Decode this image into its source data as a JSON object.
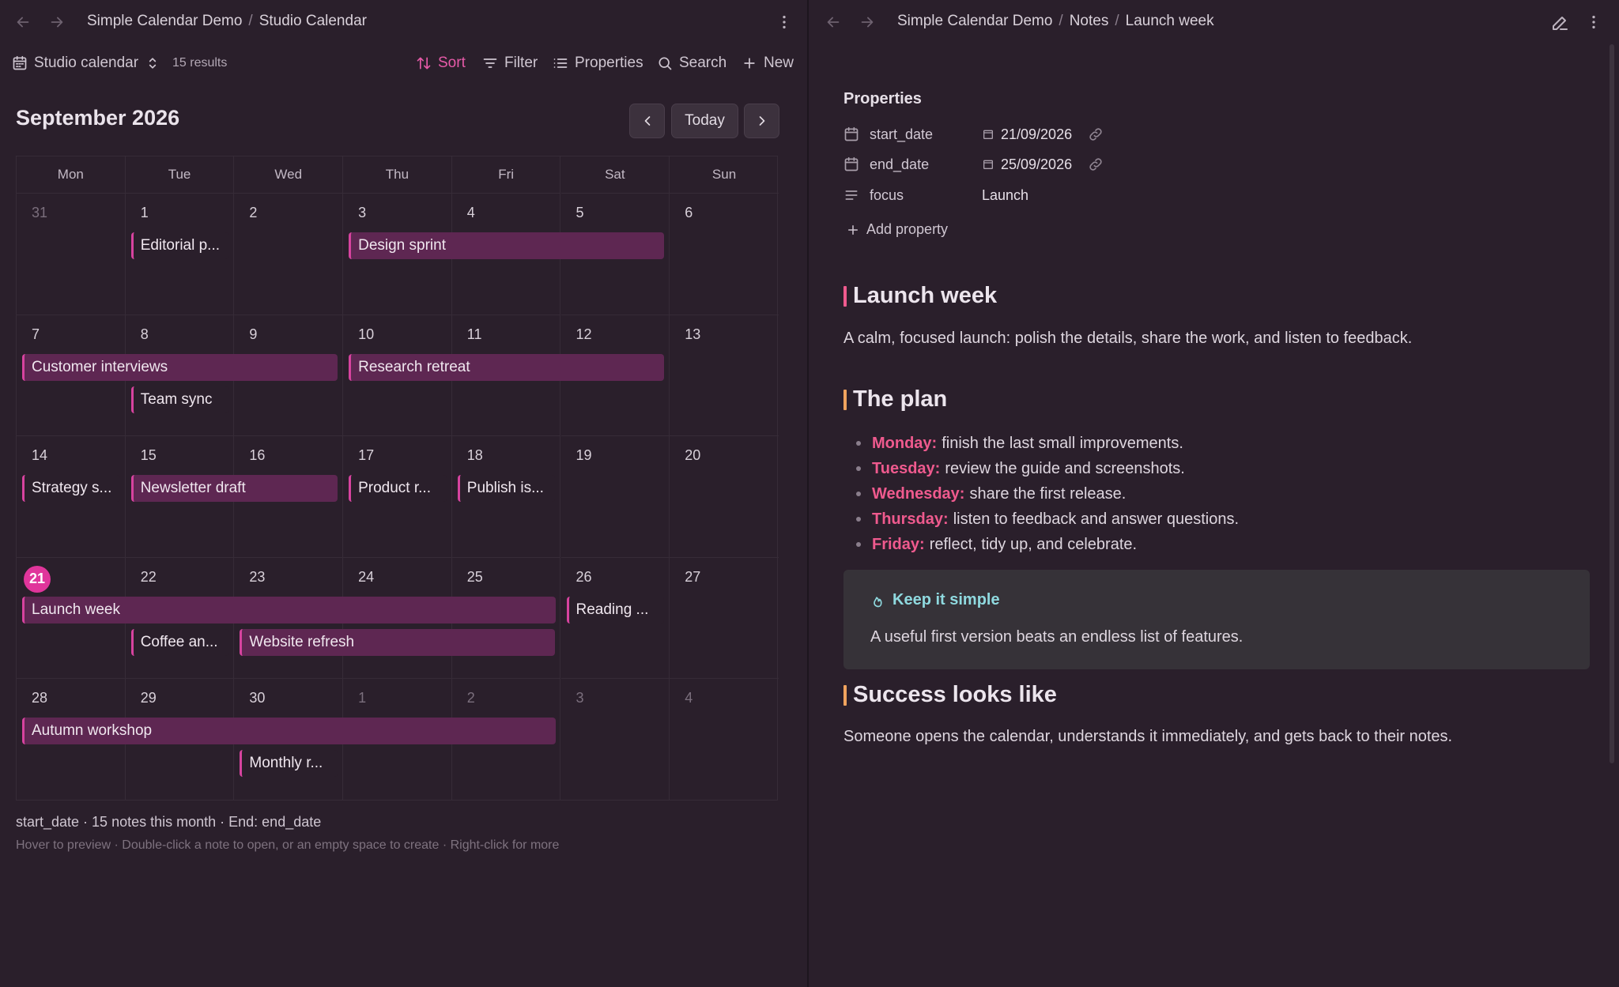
{
  "left": {
    "breadcrumb": [
      "Simple Calendar Demo",
      "Studio Calendar"
    ],
    "toolbar": {
      "view_name": "Studio calendar",
      "results": "15 results",
      "sort": "Sort",
      "filter": "Filter",
      "properties": "Properties",
      "search": "Search",
      "new": "New"
    },
    "calendar": {
      "month": "September 2026",
      "today_button": "Today",
      "weekdays": [
        "Mon",
        "Tue",
        "Wed",
        "Thu",
        "Fri",
        "Sat",
        "Sun"
      ],
      "weeks": [
        [
          {
            "n": "31",
            "dim": true
          },
          {
            "n": "1"
          },
          {
            "n": "2"
          },
          {
            "n": "3"
          },
          {
            "n": "4"
          },
          {
            "n": "5"
          },
          {
            "n": "6"
          }
        ],
        [
          {
            "n": "7"
          },
          {
            "n": "8"
          },
          {
            "n": "9"
          },
          {
            "n": "10"
          },
          {
            "n": "11"
          },
          {
            "n": "12"
          },
          {
            "n": "13"
          }
        ],
        [
          {
            "n": "14"
          },
          {
            "n": "15"
          },
          {
            "n": "16"
          },
          {
            "n": "17"
          },
          {
            "n": "18"
          },
          {
            "n": "19"
          },
          {
            "n": "20"
          }
        ],
        [
          {
            "n": "21",
            "today": true
          },
          {
            "n": "22"
          },
          {
            "n": "23"
          },
          {
            "n": "24"
          },
          {
            "n": "25"
          },
          {
            "n": "26"
          },
          {
            "n": "27"
          }
        ],
        [
          {
            "n": "28"
          },
          {
            "n": "29"
          },
          {
            "n": "30"
          },
          {
            "n": "1",
            "dim": true
          },
          {
            "n": "2",
            "dim": true
          },
          {
            "n": "3",
            "dim": true
          },
          {
            "n": "4",
            "dim": true
          }
        ]
      ],
      "events": [
        {
          "title": "Editorial p...",
          "week": 0,
          "start": 1,
          "span": 1,
          "lane": 0,
          "type": "single"
        },
        {
          "title": "Design sprint",
          "week": 0,
          "start": 3,
          "span": 3,
          "lane": 0,
          "type": "range"
        },
        {
          "title": "Customer interviews",
          "week": 1,
          "start": 0,
          "span": 3,
          "lane": 0,
          "type": "range"
        },
        {
          "title": "Research retreat",
          "week": 1,
          "start": 3,
          "span": 3,
          "lane": 0,
          "type": "range"
        },
        {
          "title": "Team sync",
          "week": 1,
          "start": 1,
          "span": 1,
          "lane": 1,
          "type": "single"
        },
        {
          "title": "Strategy s...",
          "week": 2,
          "start": 0,
          "span": 1,
          "lane": 0,
          "type": "single"
        },
        {
          "title": "Newsletter draft",
          "week": 2,
          "start": 1,
          "span": 2,
          "lane": 0,
          "type": "range"
        },
        {
          "title": "Product r...",
          "week": 2,
          "start": 3,
          "span": 1,
          "lane": 0,
          "type": "single"
        },
        {
          "title": "Publish is...",
          "week": 2,
          "start": 4,
          "span": 1,
          "lane": 0,
          "type": "single"
        },
        {
          "title": "Launch week",
          "week": 3,
          "start": 0,
          "span": 5,
          "lane": 0,
          "type": "range"
        },
        {
          "title": "Reading ...",
          "week": 3,
          "start": 5,
          "span": 1,
          "lane": 0,
          "type": "single"
        },
        {
          "title": "Coffee an...",
          "week": 3,
          "start": 1,
          "span": 1,
          "lane": 1,
          "type": "single"
        },
        {
          "title": "Website refresh",
          "week": 3,
          "start": 2,
          "span": 3,
          "lane": 1,
          "type": "range"
        },
        {
          "title": "Autumn workshop",
          "week": 4,
          "start": 0,
          "span": 5,
          "lane": 0,
          "type": "range"
        },
        {
          "title": "Monthly r...",
          "week": 4,
          "start": 2,
          "span": 1,
          "lane": 1,
          "type": "single"
        }
      ]
    },
    "footer": {
      "summary": "start_date · 15 notes this month · End: end_date",
      "hint": "Hover to preview · Double-click a note to open, or an empty space to create · Right-click for more"
    }
  },
  "right": {
    "breadcrumb": [
      "Simple Calendar Demo",
      "Notes",
      "Launch week"
    ],
    "properties_title": "Properties",
    "properties": [
      {
        "icon": "calendar-icon",
        "name": "start_date",
        "value": "21/09/2026",
        "date": true
      },
      {
        "icon": "calendar-icon",
        "name": "end_date",
        "value": "25/09/2026",
        "date": true
      },
      {
        "icon": "text-lines-icon",
        "name": "focus",
        "value": "Launch",
        "date": false
      }
    ],
    "add_property": "Add property",
    "heading1": "Launch week",
    "intro": "A calm, focused launch: polish the details, share the work, and listen to feedback.",
    "heading2": "The plan",
    "plan": [
      {
        "day": "Monday:",
        "text": "finish the last small improvements."
      },
      {
        "day": "Tuesday:",
        "text": "review the guide and screenshots."
      },
      {
        "day": "Wednesday:",
        "text": "share the first release."
      },
      {
        "day": "Thursday:",
        "text": "listen to feedback and answer questions."
      },
      {
        "day": "Friday:",
        "text": "reflect, tidy up, and celebrate."
      }
    ],
    "callout": {
      "title": "Keep it simple",
      "body": "A useful first version beats an endless list of features."
    },
    "heading3": "Success looks like",
    "success": "Someone opens the calendar, understands it immediately, and gets back to their notes."
  },
  "colors": {
    "accent": "#e0359b",
    "event_fill": "#5e2752",
    "heading_bar_red": "#ef5a8e",
    "heading_bar_orange": "#f0a35e",
    "callout_title": "#8fd9df"
  }
}
